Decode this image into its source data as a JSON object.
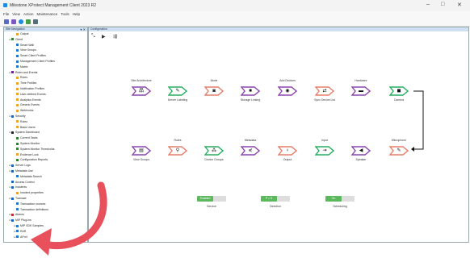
{
  "window": {
    "title": "Milestone XProtect Management Client 2023 R2",
    "minimize": "–",
    "maximize": "□",
    "close": "✕"
  },
  "menu": [
    "File",
    "View",
    "Action",
    "Maintenance",
    "Tools",
    "Help"
  ],
  "site_navigation": {
    "title": "Site Navigation",
    "controls": "▾ ✕",
    "items": [
      {
        "label": "Output",
        "indent": 2,
        "expander": "",
        "color": "#f0a020"
      },
      {
        "label": "Client",
        "indent": 1,
        "expander": "⊟",
        "color": "#2e7d32"
      },
      {
        "label": "Smart Wall",
        "indent": 2,
        "expander": "",
        "color": "#1976d2"
      },
      {
        "label": "View Groups",
        "indent": 2,
        "expander": "",
        "color": "#1976d2"
      },
      {
        "label": "Smart Client Profiles",
        "indent": 2,
        "expander": "",
        "color": "#1976d2"
      },
      {
        "label": "Management Client Profiles",
        "indent": 2,
        "expander": "",
        "color": "#1976d2"
      },
      {
        "label": "Matrix",
        "indent": 2,
        "expander": "",
        "color": "#1976d2"
      },
      {
        "label": "Rules and Events",
        "indent": 1,
        "expander": "⊟",
        "color": "#6a1b9a"
      },
      {
        "label": "Rules",
        "indent": 2,
        "expander": "",
        "color": "#f0a020"
      },
      {
        "label": "Time Profiles",
        "indent": 2,
        "expander": "",
        "color": "#f0a020"
      },
      {
        "label": "Notification Profiles",
        "indent": 2,
        "expander": "",
        "color": "#f0a020"
      },
      {
        "label": "User-defined Events",
        "indent": 2,
        "expander": "",
        "color": "#f0a020"
      },
      {
        "label": "Analytics Events",
        "indent": 2,
        "expander": "",
        "color": "#f0a020"
      },
      {
        "label": "Generic Events",
        "indent": 2,
        "expander": "",
        "color": "#f0a020"
      },
      {
        "label": "Webhooks",
        "indent": 2,
        "expander": "",
        "color": "#f0a020"
      },
      {
        "label": "Security",
        "indent": 1,
        "expander": "⊟",
        "color": "#1565c0"
      },
      {
        "label": "Roles",
        "indent": 2,
        "expander": "",
        "color": "#f0a020"
      },
      {
        "label": "Basic Users",
        "indent": 2,
        "expander": "",
        "color": "#f0a020"
      },
      {
        "label": "System Dashboard",
        "indent": 1,
        "expander": "⊟",
        "color": "#222222"
      },
      {
        "label": "Current Tasks",
        "indent": 2,
        "expander": "",
        "color": "#2e7d32"
      },
      {
        "label": "System Monitor",
        "indent": 2,
        "expander": "",
        "color": "#2e7d32"
      },
      {
        "label": "System Monitor Thresholds",
        "indent": 2,
        "expander": "",
        "color": "#2e7d32"
      },
      {
        "label": "Evidence Lock",
        "indent": 2,
        "expander": "",
        "color": "#f0a020"
      },
      {
        "label": "Configuration Reports",
        "indent": 2,
        "expander": "",
        "color": "#2e7d32"
      },
      {
        "label": "Server Logs",
        "indent": 1,
        "expander": "⊞",
        "color": "#1565c0"
      },
      {
        "label": "Metadata Use",
        "indent": 1,
        "expander": "⊟",
        "color": "#1565c0"
      },
      {
        "label": "Metadata Search",
        "indent": 2,
        "expander": "",
        "color": "#1976d2"
      },
      {
        "label": "Access Control",
        "indent": 1,
        "expander": "",
        "color": "#1565c0"
      },
      {
        "label": "Incidents",
        "indent": 1,
        "expander": "⊟",
        "color": "#1565c0"
      },
      {
        "label": "Incident properties",
        "indent": 2,
        "expander": "",
        "color": "#f0a020"
      },
      {
        "label": "Transact",
        "indent": 1,
        "expander": "⊟",
        "color": "#1565c0"
      },
      {
        "label": "Transaction sources",
        "indent": 2,
        "expander": "",
        "color": "#1976d2"
      },
      {
        "label": "Transaction definitions",
        "indent": 2,
        "expander": "",
        "color": "#1976d2"
      },
      {
        "label": "Alarms",
        "indent": 1,
        "expander": "⊞",
        "color": "#c62828"
      },
      {
        "label": "MIP Plug-ins",
        "indent": 1,
        "expander": "⊟",
        "color": "#1565c0"
      },
      {
        "label": "MIP SDK Samples",
        "indent": 2,
        "expander": "⊞",
        "color": "#1976d2"
      },
      {
        "label": "RAR",
        "indent": 2,
        "expander": "⊞",
        "color": "#1976d2"
      },
      {
        "label": "APort",
        "indent": 2,
        "expander": "⊞",
        "color": "#1976d2"
      }
    ]
  },
  "configuration": {
    "title": "Configuration",
    "toolbar": {
      "tool1": "⤡",
      "play": "▶",
      "tool3": "⇶"
    },
    "nodes": [
      {
        "title": "Site Architecture",
        "label": "",
        "glyph": "品",
        "color": "#8e44ad"
      },
      {
        "title": "",
        "label": "Server Labeling",
        "glyph": "✎",
        "color": "#27ae60"
      },
      {
        "title": "Mode",
        "label": "",
        "glyph": "◙",
        "color": "#e67e6a"
      },
      {
        "title": "",
        "label": "Storage Linking",
        "glyph": "■",
        "color": "#8e44ad"
      },
      {
        "title": "Add Devices",
        "label": "",
        "glyph": "◉",
        "color": "#8e44ad"
      },
      {
        "title": "",
        "label": "Sync Device List",
        "glyph": "⇄",
        "color": "#e67e6a"
      },
      {
        "title": "Hardware",
        "label": "",
        "glyph": "▬",
        "color": "#8e44ad"
      },
      {
        "title": "",
        "label": "Camera",
        "glyph": "◼",
        "color": "#27ae60"
      },
      {
        "title": "",
        "label": "View Groups",
        "glyph": "▤",
        "color": "#8e44ad"
      },
      {
        "title": "Rules",
        "label": "",
        "glyph": "⚲",
        "color": "#e67e6a"
      },
      {
        "title": "",
        "label": "Device Groups",
        "glyph": "⁂",
        "color": "#27ae60"
      },
      {
        "title": "Metadata",
        "label": "",
        "glyph": "⋞",
        "color": "#8e44ad"
      },
      {
        "title": "",
        "label": "Output",
        "glyph": "♀",
        "color": "#e67e6a"
      },
      {
        "title": "Input",
        "label": "",
        "glyph": "⇥",
        "color": "#27ae60"
      },
      {
        "title": "",
        "label": "Speaker",
        "glyph": "◀",
        "color": "#8e44ad"
      },
      {
        "title": "Microphone",
        "label": "",
        "glyph": "✎",
        "color": "#e67e6a"
      }
    ],
    "toggles": [
      {
        "state": "Enabled",
        "label": "Service"
      },
      {
        "state": "P = 5",
        "label": "Direction"
      },
      {
        "state": "On",
        "label": "Scheduling"
      }
    ]
  },
  "colors": {
    "accent": "#1e88e5",
    "arrow": "#e8505b",
    "header": "#cfe0f3"
  }
}
